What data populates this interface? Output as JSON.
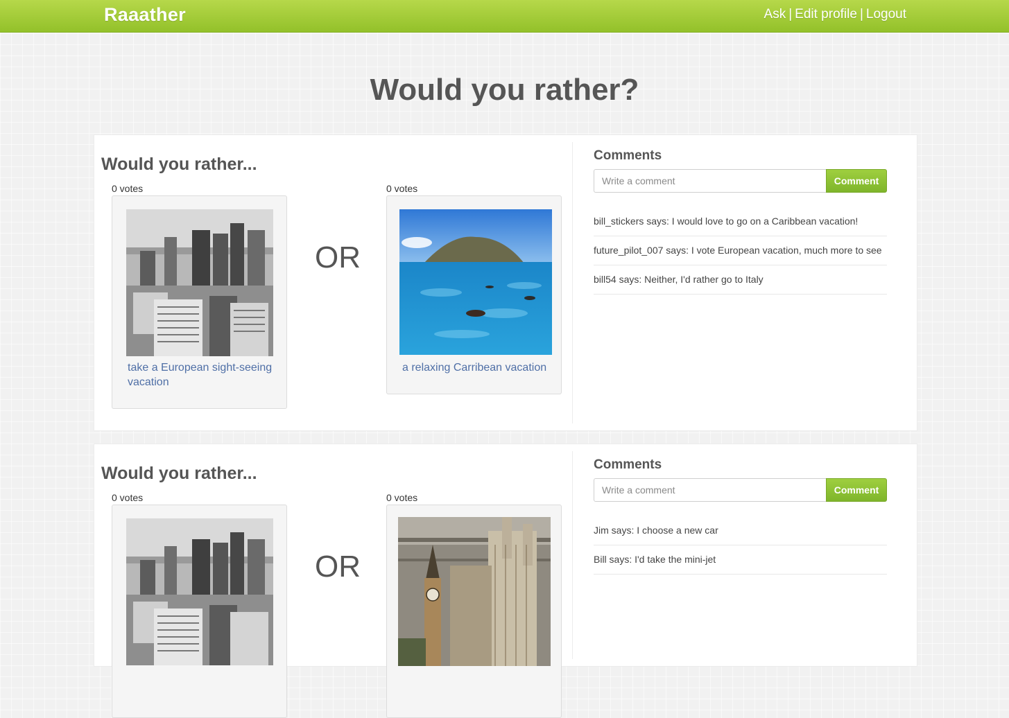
{
  "nav": {
    "brand": "Raaather",
    "links": [
      "Ask",
      "Edit profile",
      "Logout"
    ],
    "separator": "|"
  },
  "page": {
    "title": "Would you rather?"
  },
  "questions": [
    {
      "heading": "Would you rather...",
      "or_label": "OR",
      "options": [
        {
          "votes": "0 votes",
          "caption": "take a European sight-seeing vacation",
          "image": "black-and-white city skyline photo"
        },
        {
          "votes": "0 votes",
          "caption": "a relaxing Carribean vacation",
          "image": "tropical island with snorkelers photo"
        }
      ],
      "comments": {
        "heading": "Comments",
        "placeholder": "Write a comment",
        "button": "Comment",
        "items": [
          "bill_stickers says: I would love to go on a Caribbean vacation!",
          "future_pilot_007 says: I vote European vacation, much more to see",
          "bill54 says: Neither, I'd rather go to Italy"
        ]
      }
    },
    {
      "heading": "Would you rather...",
      "or_label": "OR",
      "options": [
        {
          "votes": "0 votes",
          "caption": "",
          "image": "black-and-white city skyline photo"
        },
        {
          "votes": "0 votes",
          "caption": "",
          "image": "Big Ben and Westminster aerial photo"
        }
      ],
      "comments": {
        "heading": "Comments",
        "placeholder": "Write a comment",
        "button": "Comment",
        "items": [
          "Jim says: I choose a new car",
          "Bill says: I'd take the mini-jet"
        ]
      }
    }
  ]
}
